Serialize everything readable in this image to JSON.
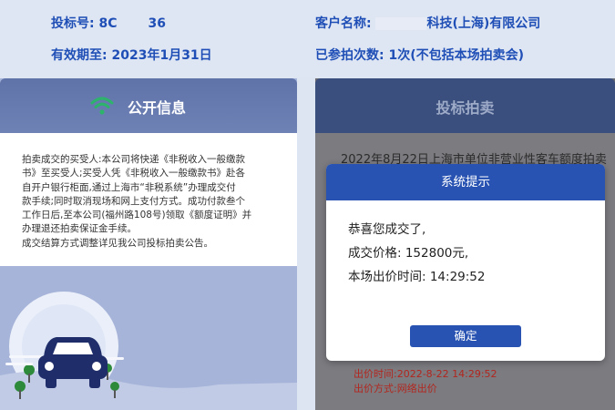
{
  "header": {
    "bid_number_label": "投标号:",
    "bid_number_value_start": "8C",
    "bid_number_value_end": "36",
    "valid_until_label": "有效期至:",
    "valid_until_value": "2023年1月31日",
    "client_name_label": "客户名称:",
    "client_name_value": "科技(上海)有限公司",
    "bids_count_label": "已参拍次数:",
    "bids_count_value": "1次(不包括本场拍卖会)"
  },
  "left_panel": {
    "title": "公开信息",
    "body_lines": [
      "拍卖成交的买受人:本公司将快递《非税收入一般缴款",
      "书》至买受人;买受人凭《非税收入一般缴款书》赴各",
      "自开户银行柜面,通过上海市“非税系统”办理成交付",
      "款手续;同时取消现场和网上支付方式。成功付款叁个",
      "工作日后,至本公司(福州路108号)领取《额度证明》并",
      "办理退还拍卖保证金手续。",
      "成交结算方式调整详见我公司投标拍卖公告。"
    ]
  },
  "right_panel": {
    "title": "投标拍卖",
    "auction_text": "2022年8月22日上海市单位非营业性客车额度拍卖",
    "bid_time": "出价时间:2022-8-22 14:29:52",
    "bid_method": "出价方式:网络出价"
  },
  "modal": {
    "title": "系统提示",
    "line1": "恭喜您成交了,",
    "line2": "成交价格: 152800元,",
    "line3": "本场出价时间: 14:29:52",
    "confirm": "确定"
  },
  "colors": {
    "accent": "#2853b2",
    "header_text": "#1f4fb6",
    "wifi_icon": "#2db36b",
    "bid_red": "#b3261e"
  }
}
